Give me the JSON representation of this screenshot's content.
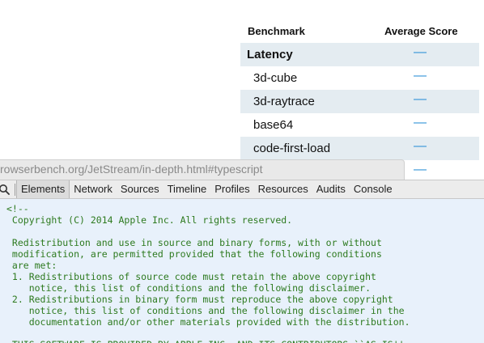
{
  "table": {
    "header": {
      "benchmark": "Benchmark",
      "average_score": "Average Score"
    },
    "rows": [
      {
        "name": "Latency",
        "score": "—"
      },
      {
        "name": "3d-cube",
        "score": "—"
      },
      {
        "name": "3d-raytrace",
        "score": "—"
      },
      {
        "name": "base64",
        "score": "—"
      },
      {
        "name": "code-first-load",
        "score": "—"
      },
      {
        "name": "",
        "score": "—"
      }
    ]
  },
  "url_bar": {
    "text": "rowserbench.org/JetStream/in-depth.html#typescript"
  },
  "inspector": {
    "tabs": [
      "Elements",
      "Network",
      "Sources",
      "Timeline",
      "Profiles",
      "Resources",
      "Audits",
      "Console"
    ],
    "selected_tab": "Elements"
  },
  "source": {
    "text": "<!--\n Copyright (C) 2014 Apple Inc. All rights reserved.\n\n Redistribution and use in source and binary forms, with or without\n modification, are permitted provided that the following conditions\n are met:\n 1. Redistributions of source code must retain the above copyright\n    notice, this list of conditions and the following disclaimer.\n 2. Redistributions in binary form must reproduce the above copyright\n    notice, this list of conditions and the following disclaimer in the\n    documentation and/or other materials provided with the distribution.\n\n THIS SOFTWARE IS PROVIDED BY APPLE INC. AND ITS CONTRIBUTORS ``AS IS''"
  },
  "colors": {
    "score_dash": "#2a8fd6",
    "shaded_row": "#e4ecf1",
    "source_text": "#2d7a1f",
    "source_bg": "#e8f1fb"
  },
  "icons": {
    "search": "search-icon"
  }
}
